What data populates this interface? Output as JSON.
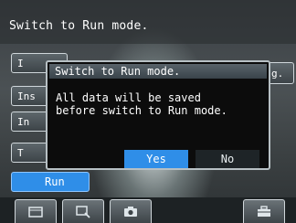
{
  "header": {
    "title": "Switch to Run mode."
  },
  "left_menu": {
    "items": [
      {
        "label": "I"
      },
      {
        "label": "Ins"
      },
      {
        "label": "In"
      },
      {
        "label": "T"
      }
    ],
    "run_label": "Run"
  },
  "right_panel": {
    "button_label": "g."
  },
  "dialog": {
    "title": "Switch to Run mode.",
    "message": "All data will be saved\nbefore switch to Run mode.",
    "yes_label": "Yes",
    "no_label": "No"
  },
  "toolbar": {
    "icons": [
      "display-icon",
      "zoom-icon",
      "camera-icon",
      "briefcase-icon"
    ]
  },
  "colors": {
    "accent": "#2f8ee8",
    "dialog_bg": "#0c0c0c",
    "title_bar": "#4a555b"
  }
}
